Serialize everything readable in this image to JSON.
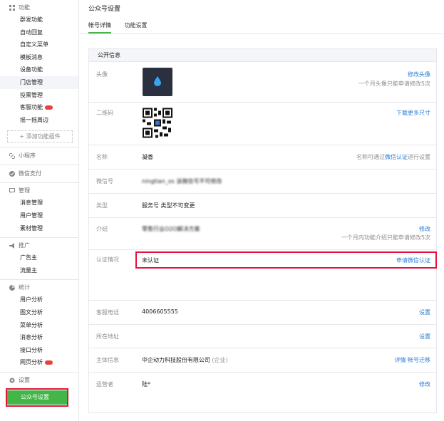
{
  "sidebar": {
    "sections": [
      {
        "title": "功能",
        "icon": "grid-icon",
        "items": [
          "群发功能",
          "自动回复",
          "自定义菜单",
          "模板消息",
          "设备功能",
          "门店管理",
          "投票管理",
          "客服功能",
          "摇一摇周边"
        ]
      },
      {
        "title": "小程序",
        "icon": "link-icon",
        "items": []
      },
      {
        "title": "微信支付",
        "icon": "check-circle-icon",
        "items": []
      },
      {
        "title": "管理",
        "icon": "chat-icon",
        "items": [
          "消息管理",
          "用户管理",
          "素材管理"
        ]
      },
      {
        "title": "推广",
        "icon": "megaphone-icon",
        "items": [
          "广告主",
          "流量主"
        ]
      },
      {
        "title": "统计",
        "icon": "pie-chart-icon",
        "items": [
          "用户分析",
          "图文分析",
          "菜单分析",
          "消息分析",
          "接口分析",
          "网页分析"
        ]
      },
      {
        "title": "设置",
        "icon": "settings-icon",
        "items": [
          "公众号设置"
        ]
      }
    ],
    "add_plugin_label": "+ 添加功能插件",
    "active_item": "公众号设置",
    "colors": {
      "active_bg": "#44b549",
      "highlight_outline": "#e5133a",
      "badge": "#e64340"
    }
  },
  "main": {
    "title": "公众号设置",
    "tabs": [
      "帐号详情",
      "功能设置"
    ],
    "active_tab": "帐号详情",
    "panel_title": "公开信息",
    "rows": {
      "avatar": {
        "label": "头像",
        "action": "修改头像",
        "note": "一个月头像只能申请修改5次"
      },
      "qrcode": {
        "label": "二维码",
        "action": "下载更多尺寸"
      },
      "name": {
        "label": "名称",
        "value": "凝香",
        "note_prefix": "名称可通过",
        "note_link": "微信认证",
        "note_suffix": "进行设置"
      },
      "wechat_id": {
        "label": "微信号",
        "value": "ningtian_os",
        "value_blurred": "该微信号不可修改"
      },
      "type": {
        "label": "类型",
        "value": "服务号 类型不可变更"
      },
      "intro": {
        "label": "介绍",
        "value_blurred": "零售行业O2O解决方案",
        "action": "修改",
        "note": "一个月内功能介绍只能申请修改5次"
      },
      "verify": {
        "label": "认证情况",
        "value": "未认证",
        "action": "申请微信认证"
      },
      "phone": {
        "label": "客服电话",
        "value": "4006605555",
        "action": "设置"
      },
      "location": {
        "label": "所在地址",
        "action": "设置"
      },
      "entity": {
        "label": "主体信息",
        "value": "中企动力科技股份有限公司",
        "value_tag": "(企业)",
        "action1": "详情",
        "action2": "帐号迁移"
      },
      "operator": {
        "label": "运营者",
        "value": "陆*",
        "action": "修改"
      }
    },
    "colors": {
      "link": "#2b7cd6",
      "tab_underline": "#44b549"
    }
  }
}
